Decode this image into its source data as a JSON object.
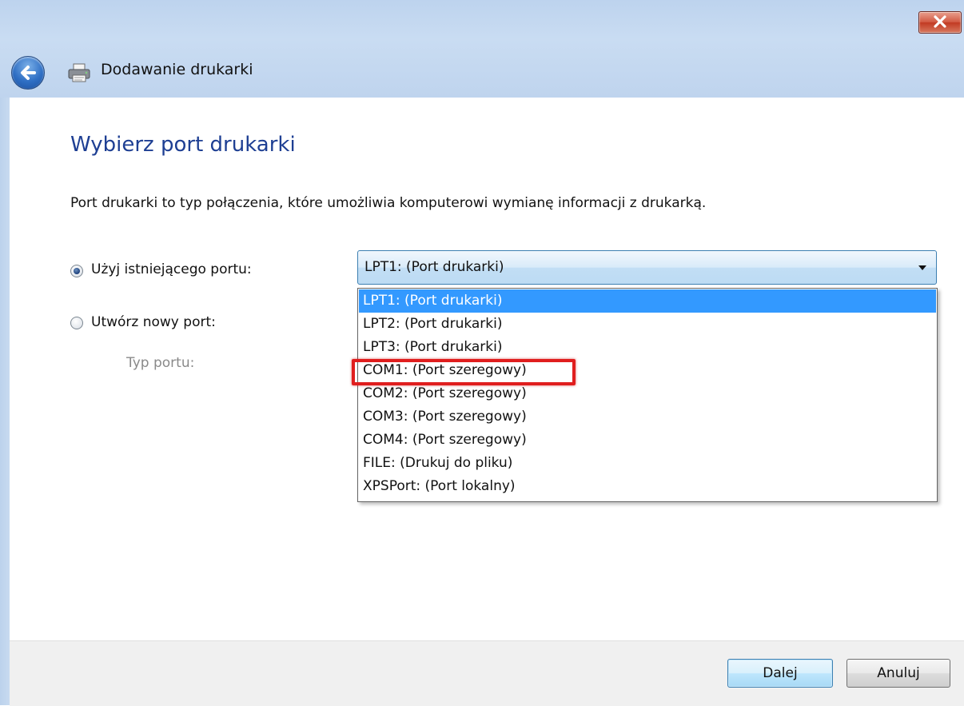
{
  "window": {
    "title": "Dodawanie drukarki"
  },
  "icons": {
    "back": "back-arrow-icon",
    "printer": "printer-icon",
    "close": "close-icon",
    "dropdown": "chevron-down-icon"
  },
  "colors": {
    "heading": "#1e3f93",
    "selection": "#3399ff",
    "highlight": "#e01e1e"
  },
  "main": {
    "heading": "Wybierz port drukarki",
    "description": "Port drukarki to typ połączenia, które umożliwia komputerowi wymianę informacji z drukarką.",
    "existing_port_label": "Użyj istniejącego portu:",
    "new_port_label": "Utwórz nowy port:",
    "port_type_label": "Typ portu:",
    "existing_port_selected": true,
    "combo": {
      "value": "LPT1: (Port drukarki)",
      "options": [
        "LPT1: (Port drukarki)",
        "LPT2: (Port drukarki)",
        "LPT3: (Port drukarki)",
        "COM1: (Port szeregowy)",
        "COM2: (Port szeregowy)",
        "COM3: (Port szeregowy)",
        "COM4: (Port szeregowy)",
        "FILE: (Drukuj do pliku)",
        "XPSPort: (Port lokalny)"
      ],
      "selected_index": 0,
      "highlighted_option": "COM1: (Port szeregowy)"
    }
  },
  "footer": {
    "next_label": "Dalej",
    "cancel_label": "Anuluj"
  }
}
